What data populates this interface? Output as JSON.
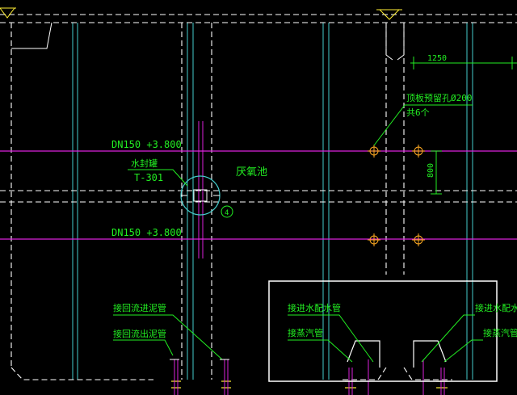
{
  "colors": {
    "background": "#000000",
    "outline": "#ffffff",
    "cyan": "#44cccc",
    "green": "#22ee22",
    "magenta": "#dd22dd",
    "orange": "#ffaa22",
    "yellow": "#ffee33",
    "dim": "#bbbbbb"
  },
  "labels": {
    "pipe_upper": "DN150 +3.800",
    "pipe_lower": "DN150 +3.800",
    "seal_valve_name": "水封罐",
    "seal_valve_tag": "T-301",
    "tank_name": "厌氧池",
    "circle_mark": "4",
    "top_dimension": "1250",
    "vertical_dimension": "800",
    "roof_holes_line1": "顶板预留孔Ø200",
    "roof_holes_line2": "共6个",
    "return_sludge_in": "接回流进泥管",
    "return_sludge_out": "接回流出泥管",
    "water_feed_left": "接进水配水管",
    "steam_pipe_left": "接蒸汽管",
    "water_feed_right": "接进水配水管",
    "steam_pipe_right": "接蒸汽管"
  },
  "icons": {
    "roof_hole": "crosshair-circle-icon",
    "support": "triangle-support-icon",
    "valve": "pipe-valve-icon"
  }
}
